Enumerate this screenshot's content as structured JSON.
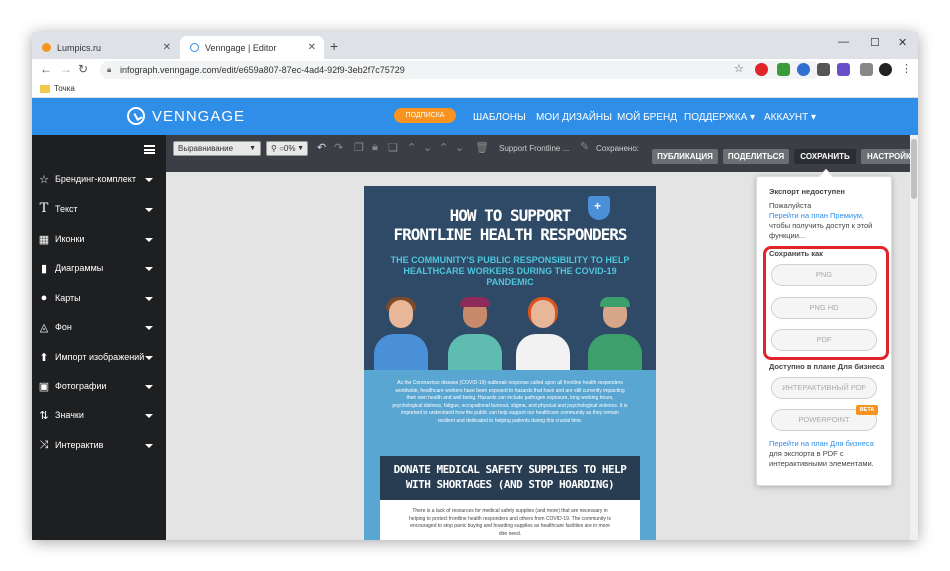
{
  "browser": {
    "tabs": [
      {
        "label": "Lumpics.ru",
        "color": "#f7931e"
      },
      {
        "label": "Venngage | Editor",
        "color": "#2e8ee8"
      }
    ],
    "url": "infograph.venngage.com/edit/e659a807-87ec-4ad4-92f9-3eb2f7c75729",
    "bookmark": "Точка",
    "new_tab": "+",
    "close": "✕",
    "window_min": "—",
    "window_max": "☐",
    "window_close": "✕"
  },
  "header": {
    "logo": "VENNGAGE",
    "subscribe": "ПОДПИСКА",
    "nav": [
      "ШАБЛОНЫ",
      "МОИ ДИЗАЙНЫ",
      "МОЙ БРЕНД",
      "ПОДДЕРЖКА ▾",
      "АККАУНТ ▾"
    ]
  },
  "toolbar": {
    "align_select": "Выравнивание",
    "zoom_select": "⚲ ○0%",
    "doc_title": "Support Frontline ...",
    "status": "Сохранено:",
    "publish": "ПУБЛИКАЦИЯ",
    "share": "ПОДЕЛИТЬСЯ",
    "save": "СОХРАНИТЬ",
    "settings": "НАСТРОЙК"
  },
  "sidebar": {
    "items": [
      {
        "label": "Брендинг-комплект",
        "icon": "☆"
      },
      {
        "label": "Текст",
        "icon": "T"
      },
      {
        "label": "Иконки",
        "icon": "▦"
      },
      {
        "label": "Диаграммы",
        "icon": "▮"
      },
      {
        "label": "Карты",
        "icon": "●"
      },
      {
        "label": "Фон",
        "icon": "◬"
      },
      {
        "label": "Импорт изображений",
        "icon": "⬆"
      },
      {
        "label": "Фотографии",
        "icon": "▣"
      },
      {
        "label": "Значки",
        "icon": "⇅"
      },
      {
        "label": "Интерактив",
        "icon": "⤨"
      }
    ]
  },
  "infographic": {
    "title_line1": "HOW TO SUPPORT",
    "title_line2": "FRONTLINE HEALTH RESPONDERS",
    "subtitle_line1": "THE COMMUNITY'S PUBLIC RESPONSIBILITY TO HELP",
    "subtitle_line2": "HEALTHCARE WORKERS DURING THE COVID-19 PANDEMIC",
    "body": "As the Coronavirus disease (COVID-19) outbreak response called upon all frontline health responders worldwide, healthcare workers have been exposed to hazards that have and are still currently impacting their own health and well being. Hazards can include pathogen exposure, long working hours, psychological distress, fatigue, occupational burnout, stigma, and physical and psychological violence. It is important to understand how the public can help support our healthcare community as they remain resilient and dedicated to helping patients during this crucial time.",
    "banner_line1": "DONATE MEDICAL SAFETY SUPPLIES TO HELP",
    "banner_line2": "WITH SHORTAGES (AND STOP HOARDING)",
    "banner_body": "There is a lack of resources for medical safety supplies (and more) that are necessary in helping to protect frontline health responders and others from COVID-19. The community is encouraged to stop panic buying and hoarding supplies as healthcare facilities are in more dire need."
  },
  "export_panel": {
    "heading": "Экспорт недоступен",
    "text1": "Пожалуйста",
    "link1": "Перейти на план Премиум,",
    "text2": "чтобы получить доступ к этой функции...",
    "save_as": "Сохранить как",
    "png": "PNG",
    "png_hd": "PNG HD",
    "pdf": "PDF",
    "business_heading": "Доступно в плане Для бизнеса",
    "interactive_pdf": "ИНТЕРАКТИВНЫЙ PDF",
    "powerpoint": "POWERPOINT",
    "beta": "BETA",
    "link2": "Перейти на план Для бизнеса",
    "text3": "для экспорта в PDF с интерактивными элементами."
  },
  "colors": {
    "brand_blue": "#2e8ee8",
    "subscribe_orange": "#f7931e",
    "highlight_red": "#e0242a",
    "sidebar_bg": "#1e1f21",
    "toolbar_bg": "#3b3f45"
  }
}
